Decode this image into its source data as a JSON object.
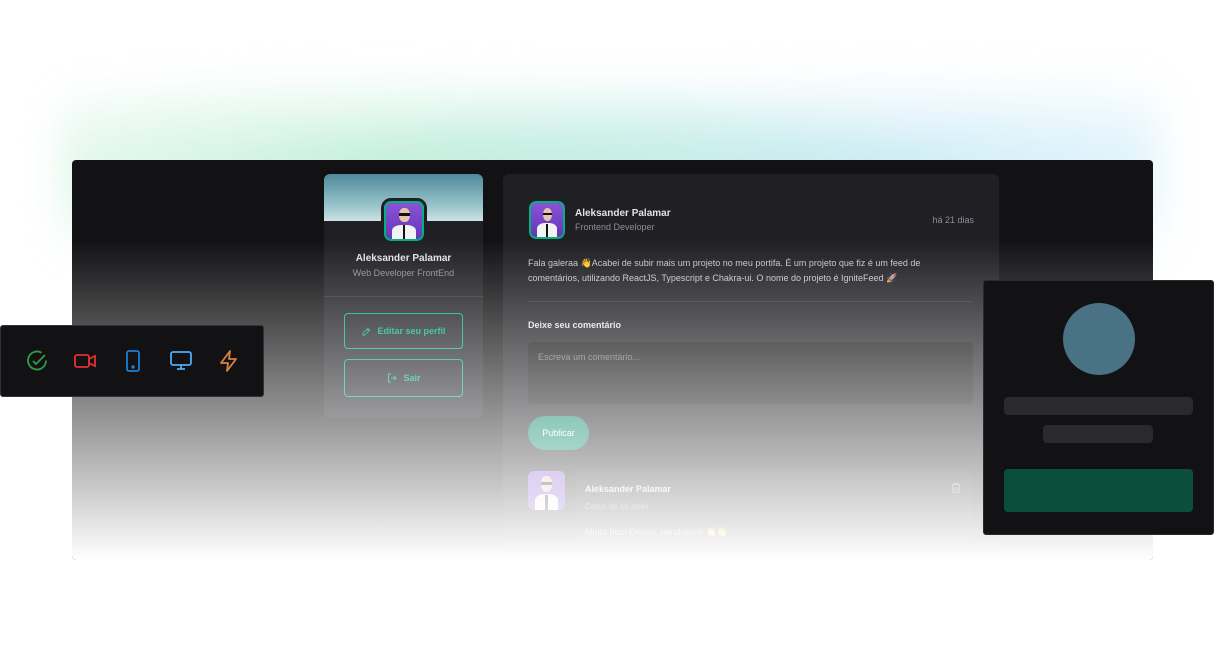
{
  "sidebar": {
    "name": "Aleksander Palamar",
    "role": "Web Developer FrontEnd",
    "edit_label": "Editar seu perfil",
    "logout_label": "Sair"
  },
  "post": {
    "author": "Aleksander Palamar",
    "role": "Frontend Developer",
    "time": "há 21 dias",
    "content": "Fala galeraa 👋Acabei de subir mais um projeto no meu portifa. É um projeto que fiz é um feed de comentários, utilizando ReactJS, Typescript e Chakra-ui. O nome do projeto é IgniteFeed 🚀",
    "comment_label": "Deixe seu comentário",
    "comment_placeholder": "Escreva um comentário...",
    "publish_label": "Publicar"
  },
  "comment": {
    "author": "Aleksander Palamar",
    "time": "Cerca de 1h atrás",
    "text": "Muito bom Devon, parabéns!! 👏👏"
  },
  "toolbar": {
    "icons": [
      "check-circle-icon",
      "video-icon",
      "smartphone-icon",
      "monitor-icon",
      "lightning-icon"
    ]
  },
  "colors": {
    "accent": "#00b37e",
    "background": "#121214",
    "surface": "#202024",
    "check": "#2f9e44",
    "video": "#e03131",
    "phone": "#1c7ed6",
    "monitor": "#4dabf7",
    "bolt": "#d9823b"
  }
}
